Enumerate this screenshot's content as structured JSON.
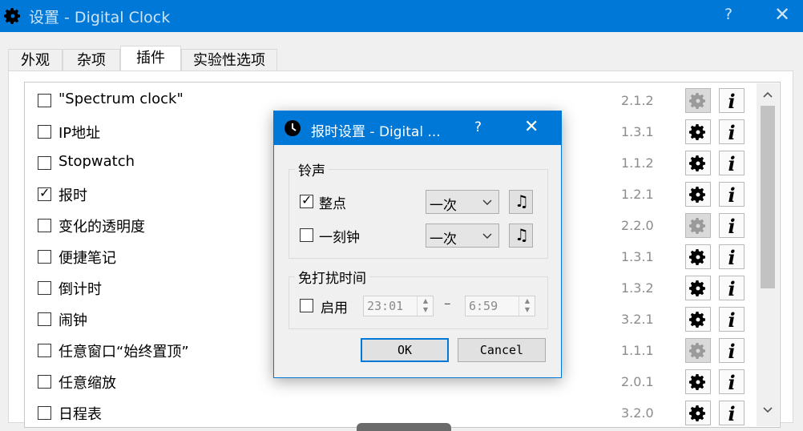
{
  "window": {
    "title": "设置 - Digital Clock",
    "help": "?",
    "close": "✕"
  },
  "tabs": [
    {
      "label": "外观",
      "active": false
    },
    {
      "label": "杂项",
      "active": false
    },
    {
      "label": "插件",
      "active": true
    },
    {
      "label": "实验性选项",
      "active": false
    }
  ],
  "plugins": [
    {
      "name": "\"Spectrum clock\"",
      "checked": false,
      "version": "2.1.2",
      "config_enabled": false
    },
    {
      "name": "IP地址",
      "checked": false,
      "version": "1.3.1",
      "config_enabled": true
    },
    {
      "name": "Stopwatch",
      "checked": false,
      "version": "1.1.2",
      "config_enabled": true
    },
    {
      "name": "报时",
      "checked": true,
      "version": "1.2.1",
      "config_enabled": true
    },
    {
      "name": "变化的透明度",
      "checked": false,
      "version": "2.2.0",
      "config_enabled": false
    },
    {
      "name": "便捷笔记",
      "checked": false,
      "version": "1.3.1",
      "config_enabled": true
    },
    {
      "name": "倒计时",
      "checked": false,
      "version": "1.3.2",
      "config_enabled": true
    },
    {
      "name": "闹钟",
      "checked": false,
      "version": "3.2.1",
      "config_enabled": true
    },
    {
      "name": "任意窗口“始终置顶”",
      "checked": false,
      "version": "1.1.1",
      "config_enabled": false
    },
    {
      "name": "任意缩放",
      "checked": false,
      "version": "2.0.1",
      "config_enabled": true
    },
    {
      "name": "日程表",
      "checked": false,
      "version": "3.2.0",
      "config_enabled": true
    }
  ],
  "info_glyph": "i",
  "scroll": {
    "up": "^",
    "down": "v"
  },
  "dialog": {
    "title": "报时设置 - Digital ...",
    "help": "?",
    "close": "✕",
    "ringtone_group": "铃声",
    "hourly": {
      "label": "整点",
      "checked": true,
      "select": "一次"
    },
    "quarter": {
      "label": "一刻钟",
      "checked": false,
      "select": "一次"
    },
    "music_glyph": "♫",
    "quiet_group": "免打扰时间",
    "quiet_enable": {
      "label": "启用",
      "checked": false
    },
    "quiet_from": "23:01",
    "quiet_dash": "–",
    "quiet_to": "6:59",
    "ok": "OK",
    "cancel": "Cancel"
  },
  "colors": {
    "accent": "#0078d7",
    "disabled_button": "#dadada"
  }
}
